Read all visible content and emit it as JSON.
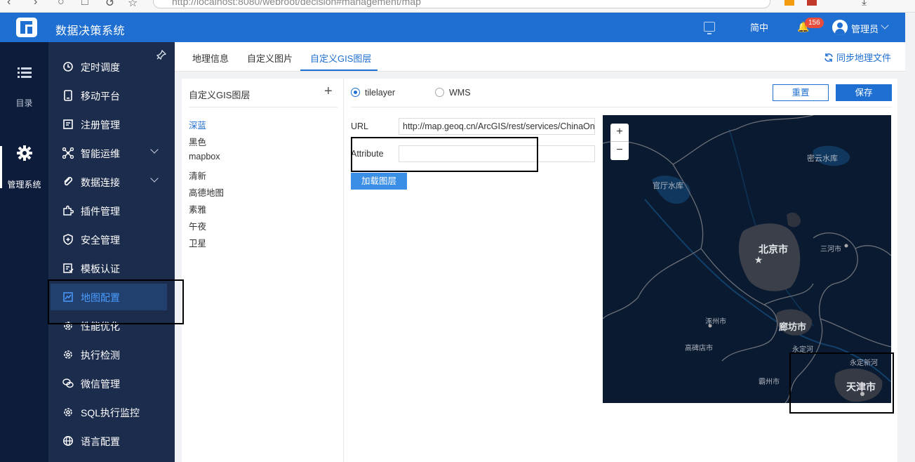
{
  "browser": {
    "url": "http://localhost:8080/webroot/decision#management/map"
  },
  "header": {
    "title": "数据决策系统",
    "language": "简中",
    "notification_count": "156",
    "user": "管理员"
  },
  "rail": {
    "items": [
      {
        "label": "目录",
        "icon": "list-icon"
      },
      {
        "label": "管理系统",
        "icon": "gear-icon"
      }
    ]
  },
  "menu": {
    "items": [
      {
        "label": "定时调度",
        "icon": "clock-icon"
      },
      {
        "label": "移动平台",
        "icon": "mobile-icon"
      },
      {
        "label": "注册管理",
        "icon": "register-icon"
      },
      {
        "label": "智能运维",
        "icon": "network-icon",
        "expandable": true
      },
      {
        "label": "数据连接",
        "icon": "link-icon",
        "expandable": true
      },
      {
        "label": "插件管理",
        "icon": "puzzle-icon"
      },
      {
        "label": "安全管理",
        "icon": "shield-icon"
      },
      {
        "label": "模板认证",
        "icon": "template-icon"
      },
      {
        "label": "地图配置",
        "icon": "map-icon",
        "active": true
      },
      {
        "label": "性能优化",
        "icon": "gear-icon"
      },
      {
        "label": "执行检测",
        "icon": "gear-icon"
      },
      {
        "label": "微信管理",
        "icon": "wechat-icon"
      },
      {
        "label": "SQL执行监控",
        "icon": "gear-icon"
      },
      {
        "label": "语言配置",
        "icon": "globe-icon"
      }
    ]
  },
  "tabs": {
    "items": [
      "地理信息",
      "自定义图片",
      "自定义GIS图层"
    ],
    "active": 2,
    "sync_label": "同步地理文件"
  },
  "layers": {
    "title": "自定义GIS图层",
    "items": [
      "深蓝",
      "黑色",
      "mapbox",
      "清新",
      "高德地图",
      "素雅",
      "午夜",
      "卫星"
    ],
    "active": 0
  },
  "form": {
    "radio_tilelayer": "tilelayer",
    "radio_wms": "WMS",
    "reset_label": "重置",
    "save_label": "保存",
    "url_label": "URL",
    "url_value": "http://map.geoq.cn/ArcGIS/rest/services/ChinaOnlineStreetPurplishBlue/MapServer/tile/{z}/{y}/{x}",
    "attribute_label": "Attribute",
    "attribute_value": "",
    "load_label": "加载图层"
  },
  "map": {
    "zoom_in": "+",
    "zoom_out": "−",
    "labels": [
      {
        "text": "密云水库",
        "kind": "water"
      },
      {
        "text": "官厅水库",
        "kind": "water"
      },
      {
        "text": "北京市",
        "kind": "capital"
      },
      {
        "text": "三河市",
        "kind": "city"
      },
      {
        "text": "涿州市",
        "kind": "city"
      },
      {
        "text": "廊坊市",
        "kind": "major"
      },
      {
        "text": "高碑店市",
        "kind": "city"
      },
      {
        "text": "永定河",
        "kind": "water"
      },
      {
        "text": "永定新河",
        "kind": "water"
      },
      {
        "text": "霸州市",
        "kind": "city"
      },
      {
        "text": "天津市",
        "kind": "capital"
      }
    ],
    "colors": {
      "background": "#0a1a30",
      "urban": "#3a3f4a",
      "border": "#6b6f78",
      "water": "#12406a"
    }
  }
}
